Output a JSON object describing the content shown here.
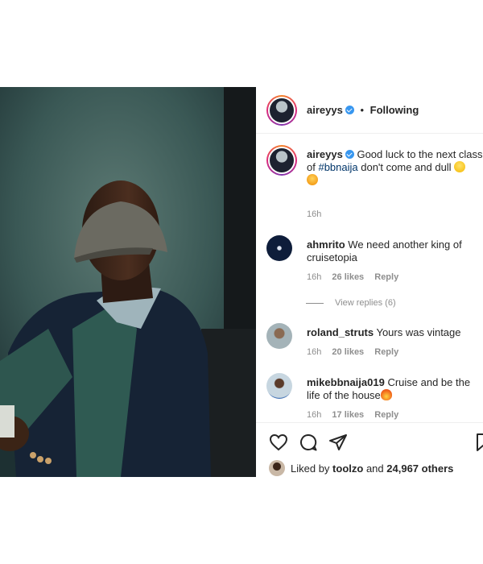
{
  "post": {
    "author": "aireyys",
    "following_label": "Following",
    "separator": "•"
  },
  "caption": {
    "username": "aireyys",
    "text_before": "Good luck to the next class of ",
    "hashtag": "#bbnaija",
    "text_after": " don't come and dull",
    "time": "16h"
  },
  "comments": [
    {
      "username": "ahmrito",
      "text": "We need another king of cruisetopia",
      "time": "16h",
      "likes": "26 likes",
      "reply": "Reply"
    },
    {
      "username": "roland_struts",
      "text": "Yours was vintage",
      "time": "16h",
      "likes": "20 likes",
      "reply": "Reply"
    },
    {
      "username": "mikebbnaija019",
      "text": "Cruise and be the life of the house",
      "time": "16h",
      "likes": "17 likes",
      "reply": "Reply"
    }
  ],
  "view_replies": "View replies (6)",
  "likes": {
    "prefix": "Liked by",
    "user": "toolzo",
    "conj": "and",
    "count": "24,967 others"
  },
  "icons": {
    "like": "heart-icon",
    "comment": "comment-icon",
    "share": "share-icon",
    "save": "bookmark-icon",
    "verified": "verified-badge-icon"
  },
  "colors": {
    "verified": "#3897f0",
    "hashtag": "#003569",
    "muted": "#8e8e8e",
    "text": "#262626"
  }
}
